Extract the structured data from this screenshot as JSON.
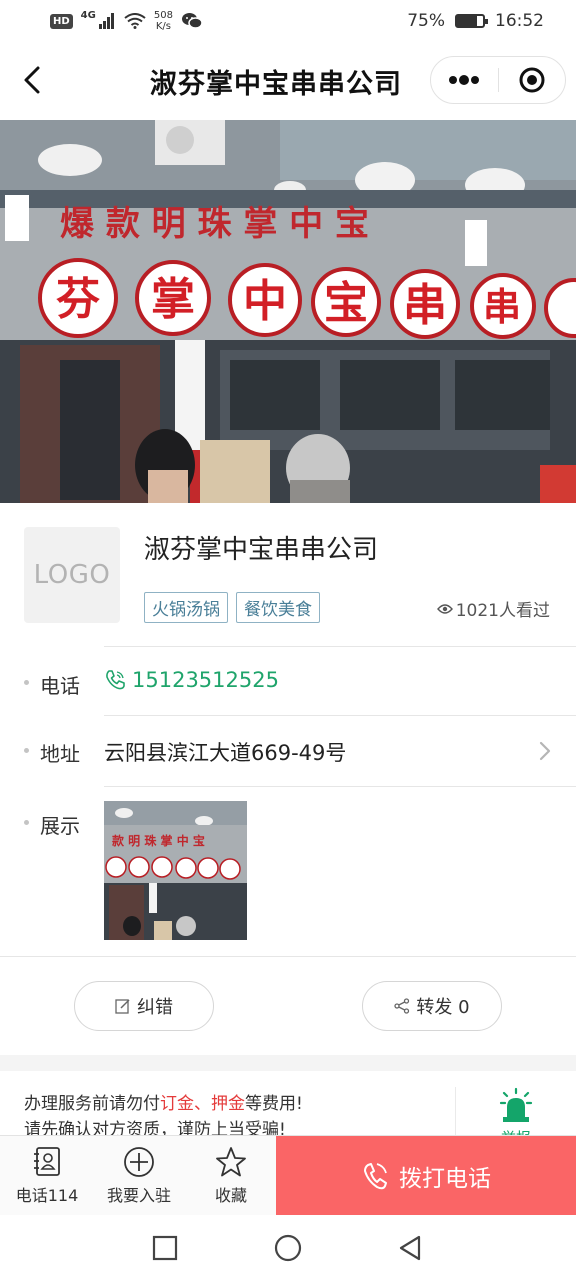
{
  "status_bar": {
    "hd": "HD",
    "network": "4G",
    "speed_value": "508",
    "speed_unit": "K/s",
    "battery_percent": "75%",
    "battery_level": 0.75,
    "time": "16:52"
  },
  "nav": {
    "title": "淑芬掌中宝串串公司"
  },
  "company": {
    "logo_placeholder": "LOGO",
    "name": "淑芬掌中宝串串公司",
    "tags": [
      "火锅汤锅",
      "餐饮美食"
    ],
    "views": "1021人看过"
  },
  "details": {
    "phone_label": "电话",
    "phone_value": "15123512525",
    "address_label": "地址",
    "address_value": "云阳县滨江大道669-49号",
    "display_label": "展示"
  },
  "actions": {
    "correct_label": "纠错",
    "share_label": "转发 0"
  },
  "notice": {
    "line1_before": "办理服务前请勿付",
    "line1_red": "订金、押金",
    "line1_after": "等费用!",
    "line2": "请先确认对方资质，谨防上当受骗!",
    "report_label": "举报"
  },
  "toolbar": {
    "phone114_label": "电话114",
    "join_label": "我要入驻",
    "favorite_label": "收藏",
    "call_label": "拨打电话"
  },
  "colors": {
    "accent_green": "#1fa46b",
    "call_red": "#fa6566",
    "tag_blue": "#4a7f98"
  }
}
